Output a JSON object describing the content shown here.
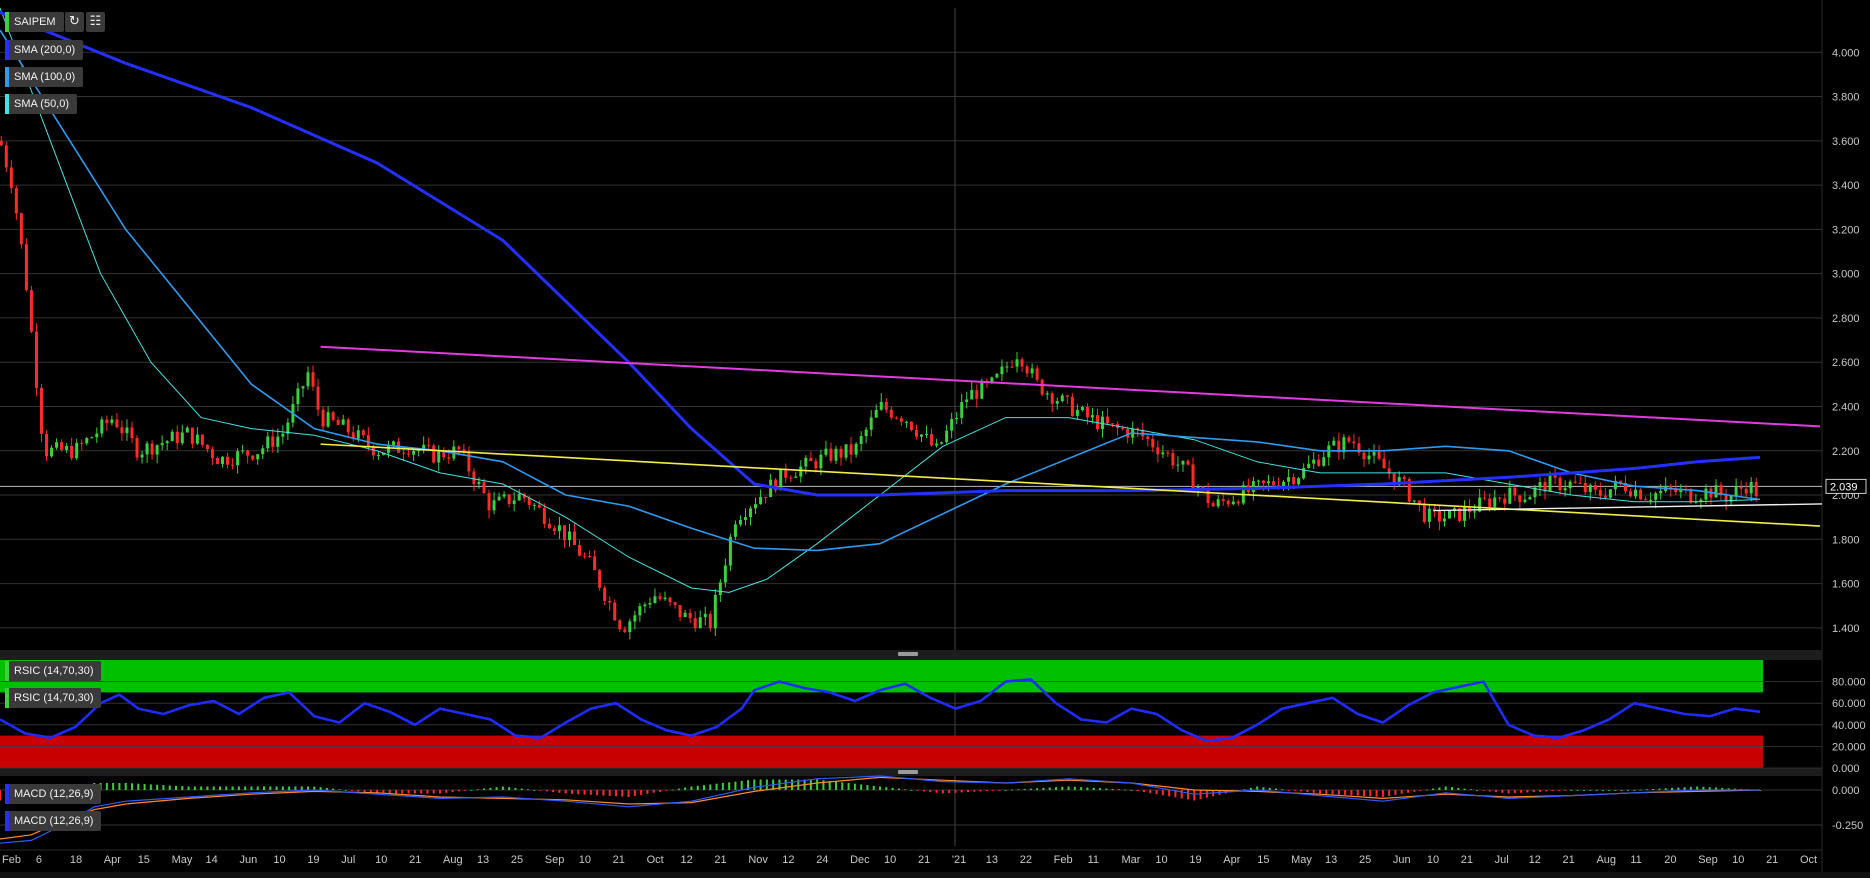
{
  "legend": {
    "symbol": {
      "label": "SAIPEM",
      "color": "#3ad13a"
    },
    "sma200": {
      "label": "SMA (200,0)",
      "color": "#2430ff"
    },
    "sma100": {
      "label": "SMA (100,0)",
      "color": "#2e9bf0"
    },
    "sma50": {
      "label": "SMA (50,0)",
      "color": "#45e2e2"
    },
    "rsi1": {
      "label": "RSIC (14,70,30)",
      "color": "#3ad13a"
    },
    "rsi2": {
      "label": "RSIC (14,70,30)",
      "color": "#3ad13a"
    },
    "macd1": {
      "label": "MACD (12,26,9)",
      "color": "#2430ff"
    },
    "macd2": {
      "label": "MACD (12,26,9)",
      "color": "#2430ff"
    }
  },
  "toolbar": {
    "refresh_icon": "refresh-icon",
    "indicator_icon": "chart-settings-icon"
  },
  "colors": {
    "up_candle": "#3ad13a",
    "down_candle": "#ff2a2a",
    "resistance_line": "#e23be2",
    "support_line": "#f2ee45",
    "sma200": "#2430ff",
    "sma100": "#2e9bf0",
    "sma50": "#45e2e2",
    "rsi_line": "#1f2cff",
    "overbought_zone": "#00c000",
    "oversold_zone": "#c80000",
    "macd_line": "#2e5bff",
    "signal_line": "#ff8a2a",
    "grid": "#333333"
  },
  "chart_data": {
    "type": "line",
    "title": "",
    "price_axis": {
      "ticks": [
        "4.000",
        "3.800",
        "3.600",
        "3.400",
        "3.200",
        "3.000",
        "2.800",
        "2.600",
        "2.400",
        "2.200",
        "2.000",
        "1.800",
        "1.600",
        "1.400"
      ],
      "ylim": [
        1.3,
        4.2
      ]
    },
    "last_price": "2.039",
    "x_axis_labels": [
      "Feb",
      "6",
      "18",
      "Apr",
      "15",
      "May",
      "14",
      "Jun",
      "10",
      "19",
      "Jul",
      "10",
      "21",
      "Aug",
      "13",
      "25",
      "Sep",
      "10",
      "21",
      "Oct",
      "12",
      "21",
      "Nov",
      "12",
      "24",
      "Dec",
      "10",
      "21",
      "'21",
      "13",
      "22",
      "Feb",
      "11",
      "Mar",
      "10",
      "19",
      "Apr",
      "15",
      "May",
      "13",
      "25",
      "Jun",
      "10",
      "21",
      "Jul",
      "12",
      "21",
      "Aug",
      "11",
      "20",
      "Sep",
      "10",
      "21",
      "Oct"
    ],
    "price_series": {
      "name": "SAIPEM",
      "x": [
        0,
        10,
        20,
        35,
        60,
        90,
        110,
        150,
        175,
        205,
        225,
        245,
        255,
        275,
        300,
        325,
        345,
        365,
        390,
        415,
        445,
        470,
        495,
        520,
        545,
        565,
        585,
        605,
        625,
        645,
        660,
        680,
        700,
        720,
        745,
        770,
        790,
        810,
        825,
        845,
        865,
        885,
        905,
        925,
        945,
        965,
        985,
        1010,
        1035,
        1055,
        1075,
        1095,
        1115,
        1135,
        1155,
        1175,
        1195,
        1215,
        1230,
        1250,
        1270,
        1290,
        1310,
        1330,
        1345,
        1360,
        1375,
        1390,
        1400
      ],
      "y": [
        3.6,
        3.4,
        3.0,
        2.2,
        2.2,
        2.35,
        2.2,
        2.28,
        2.16,
        2.2,
        2.28,
        2.55,
        2.35,
        2.3,
        2.2,
        2.22,
        2.18,
        2.2,
        1.95,
        2.0,
        1.85,
        1.68,
        1.4,
        1.55,
        1.45,
        1.42,
        1.9,
        2.0,
        2.1,
        2.14,
        2.18,
        2.2,
        2.4,
        2.35,
        2.2,
        2.45,
        2.5,
        2.65,
        2.5,
        2.42,
        2.35,
        2.3,
        2.28,
        2.2,
        2.1,
        1.95,
        2.0,
        2.05,
        2.1,
        2.2,
        2.25,
        2.15,
        2.05,
        1.9,
        1.9,
        1.95,
        2.0,
        2.0,
        2.05,
        2.05,
        2.0,
        2.05,
        2.0,
        2.02,
        2.0,
        2.02,
        1.99,
        2.05,
        2.0
      ]
    },
    "sma200": {
      "name": "SMA (200,0)",
      "x": [
        0,
        100,
        200,
        300,
        400,
        500,
        550,
        600,
        650,
        700,
        800,
        900,
        1000,
        1100,
        1200,
        1300,
        1350,
        1400
      ],
      "y": [
        4.18,
        3.95,
        3.75,
        3.5,
        3.15,
        2.6,
        2.3,
        2.05,
        2.0,
        2.0,
        2.02,
        2.02,
        2.03,
        2.05,
        2.08,
        2.12,
        2.15,
        2.17
      ]
    },
    "sma100": {
      "name": "SMA (100,0)",
      "x": [
        0,
        50,
        100,
        150,
        200,
        250,
        300,
        350,
        400,
        450,
        500,
        550,
        600,
        650,
        700,
        800,
        900,
        1000,
        1050,
        1100,
        1150,
        1200,
        1250,
        1300,
        1350,
        1400
      ],
      "y": [
        4.1,
        3.65,
        3.2,
        2.85,
        2.5,
        2.3,
        2.23,
        2.2,
        2.15,
        2.0,
        1.95,
        1.85,
        1.76,
        1.75,
        1.78,
        2.05,
        2.28,
        2.24,
        2.2,
        2.2,
        2.22,
        2.2,
        2.1,
        2.04,
        2.02,
        1.98
      ]
    },
    "sma50": {
      "name": "SMA (50,0)",
      "x": [
        0,
        40,
        80,
        120,
        160,
        200,
        250,
        300,
        350,
        400,
        450,
        500,
        550,
        580,
        610,
        650,
        700,
        750,
        800,
        850,
        900,
        950,
        1000,
        1050,
        1100,
        1150,
        1200,
        1250,
        1300,
        1350,
        1400
      ],
      "y": [
        4.2,
        3.6,
        3.0,
        2.6,
        2.35,
        2.3,
        2.27,
        2.2,
        2.1,
        2.05,
        1.9,
        1.72,
        1.58,
        1.56,
        1.62,
        1.78,
        2.0,
        2.22,
        2.35,
        2.35,
        2.3,
        2.25,
        2.15,
        2.1,
        2.1,
        2.1,
        2.05,
        2.0,
        1.97,
        1.97,
        1.98
      ]
    },
    "resistance_trendline": {
      "x": [
        255,
        1400
      ],
      "y": [
        2.67,
        2.31
      ]
    },
    "support_trendline": {
      "x": [
        255,
        1400
      ],
      "y": [
        2.23,
        1.86
      ]
    },
    "rsi": {
      "name": "RSIC (14,70,30)",
      "ylim": [
        0,
        100
      ],
      "ticks": [
        "80.000",
        "60.000",
        "40.000",
        "20.000",
        "0.000"
      ],
      "overbought": 70,
      "oversold": 30,
      "x": [
        0,
        20,
        40,
        60,
        80,
        95,
        110,
        130,
        150,
        170,
        190,
        210,
        230,
        250,
        270,
        290,
        310,
        330,
        350,
        370,
        390,
        410,
        430,
        450,
        470,
        490,
        510,
        530,
        550,
        570,
        590,
        600,
        620,
        640,
        660,
        680,
        700,
        720,
        740,
        760,
        780,
        800,
        820,
        840,
        860,
        880,
        900,
        920,
        940,
        960,
        980,
        1000,
        1020,
        1040,
        1060,
        1080,
        1100,
        1120,
        1140,
        1160,
        1180,
        1200,
        1220,
        1240,
        1260,
        1280,
        1300,
        1320,
        1340,
        1360,
        1380,
        1400
      ],
      "y": [
        45,
        32,
        28,
        38,
        60,
        68,
        55,
        50,
        58,
        62,
        50,
        65,
        70,
        48,
        42,
        60,
        52,
        40,
        55,
        50,
        45,
        30,
        28,
        42,
        55,
        60,
        45,
        35,
        30,
        38,
        55,
        72,
        80,
        74,
        70,
        62,
        72,
        78,
        65,
        55,
        62,
        80,
        82,
        60,
        45,
        42,
        55,
        50,
        35,
        25,
        28,
        40,
        55,
        60,
        65,
        50,
        42,
        58,
        70,
        75,
        80,
        40,
        30,
        28,
        35,
        45,
        60,
        55,
        50,
        48,
        55,
        52
      ]
    },
    "macd": {
      "name": "MACD (12,26,9)",
      "ylim": [
        -0.4,
        0.1
      ],
      "ticks": [
        "0.000",
        "-0.250"
      ],
      "x": [
        0,
        25,
        50,
        75,
        100,
        150,
        200,
        250,
        300,
        350,
        400,
        450,
        500,
        550,
        600,
        650,
        700,
        750,
        800,
        850,
        900,
        950,
        1000,
        1050,
        1100,
        1150,
        1200,
        1250,
        1300,
        1350,
        1400
      ],
      "macd_y": [
        -0.38,
        -0.36,
        -0.25,
        -0.12,
        -0.08,
        -0.05,
        -0.02,
        0.0,
        -0.03,
        -0.06,
        -0.05,
        -0.08,
        -0.12,
        -0.08,
        0.02,
        0.08,
        0.1,
        0.06,
        0.05,
        0.08,
        0.05,
        -0.03,
        0.0,
        -0.04,
        -0.08,
        -0.02,
        -0.06,
        -0.04,
        -0.02,
        0.0,
        0.0
      ],
      "signal_y": [
        -0.35,
        -0.32,
        -0.22,
        -0.14,
        -0.1,
        -0.06,
        -0.03,
        -0.01,
        -0.02,
        -0.05,
        -0.06,
        -0.07,
        -0.1,
        -0.09,
        -0.01,
        0.05,
        0.09,
        0.07,
        0.05,
        0.07,
        0.05,
        0.0,
        -0.01,
        -0.03,
        -0.06,
        -0.03,
        -0.05,
        -0.04,
        -0.02,
        -0.01,
        0.0
      ]
    }
  }
}
